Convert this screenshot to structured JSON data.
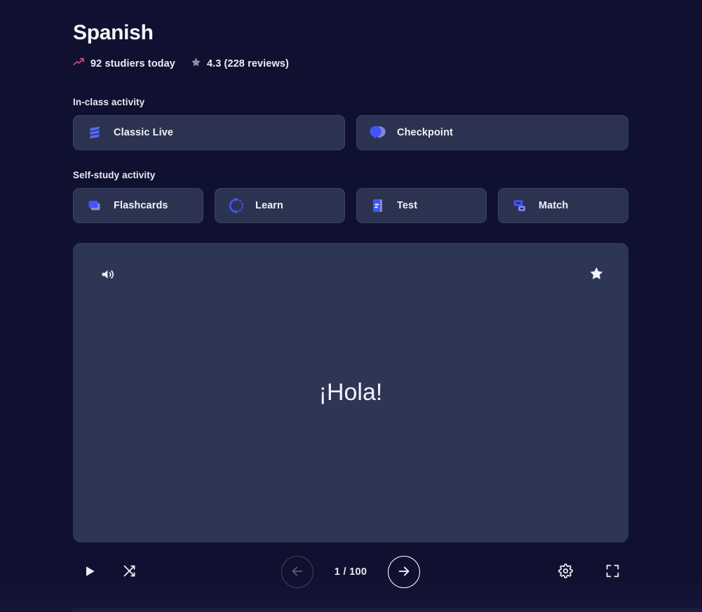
{
  "header": {
    "title": "Spanish",
    "studiers_text": "92 studiers today",
    "studiers_icon": "trending-up-icon",
    "rating_text": "4.3 (228 reviews)",
    "rating_icon": "star-icon",
    "trending_color": "#e0457b",
    "rating_star_color": "#8b8fa8"
  },
  "sections": {
    "in_class_label": "In-class activity",
    "self_study_label": "Self-study activity"
  },
  "in_class_activities": [
    {
      "label": "Classic Live",
      "icon": "classic-live-icon"
    },
    {
      "label": "Checkpoint",
      "icon": "checkpoint-icon"
    }
  ],
  "self_study_activities": [
    {
      "label": "Flashcards",
      "icon": "flashcards-icon"
    },
    {
      "label": "Learn",
      "icon": "learn-icon"
    },
    {
      "label": "Test",
      "icon": "test-icon"
    },
    {
      "label": "Match",
      "icon": "match-icon"
    }
  ],
  "flashcard": {
    "term": "¡Hola!",
    "audio_icon": "speaker-audio-icon",
    "star_icon": "star-filled-icon",
    "starred": true,
    "background": "#2e3655"
  },
  "controls": {
    "play_icon": "play-icon",
    "shuffle_icon": "shuffle-icon",
    "prev_icon": "arrow-left-icon",
    "next_icon": "arrow-right-icon",
    "counter": "1 / 100",
    "current_card": 1,
    "total_cards": 100,
    "prev_disabled": true,
    "settings_icon": "gear-icon",
    "fullscreen_icon": "fullscreen-icon"
  },
  "theme": {
    "page_bg": "#101130",
    "button_bg": "#2c3350",
    "button_border": "#3b4365",
    "accent_blue": "#4255ff",
    "icon_blue": "#5269ff",
    "text_primary": "#f0f1f7"
  }
}
